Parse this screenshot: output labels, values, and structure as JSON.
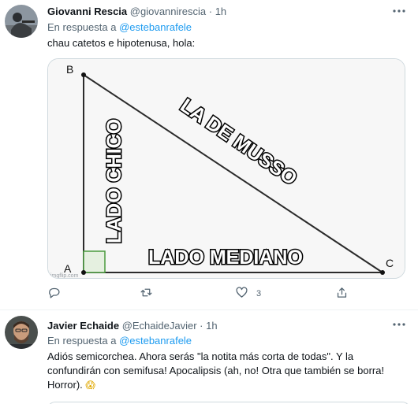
{
  "tweets": [
    {
      "name": "Giovanni Rescia",
      "handle": "@giovannirescia",
      "dot": "·",
      "time": "1h",
      "reply_prefix": "En respuesta a ",
      "reply_mention": "@estebanrafele",
      "text": "chau catetos e hipotenusa, hola:",
      "media": {
        "vertex_b": "B",
        "vertex_a": "A",
        "vertex_c": "C",
        "label_left": "LADO CHICO",
        "label_hyp": "LA DE MUSSO",
        "label_bottom": "LADO MEDIANO",
        "watermark": "imgflip.com"
      },
      "stats": {
        "likes": "3"
      }
    },
    {
      "name": "Javier Echaide",
      "handle": "@EchaideJavier",
      "dot": "·",
      "time": "1h",
      "reply_prefix": "En respuesta a ",
      "reply_mention": "@estebanrafele",
      "text": "Adiós semicorchea. Ahora serás \"la notita más corta de todas\". Y la confundirán con semifusa! Apocalipsis (ah, no! Otra que también se borra! Horror).",
      "emoji": "😱"
    }
  ],
  "icons": {
    "more": "more-horizontal-icon",
    "reply": "reply-icon",
    "retweet": "retweet-icon",
    "like": "heart-icon",
    "share": "share-icon"
  },
  "colors": {
    "accent": "#1d9bf0",
    "secondary_text": "#536471",
    "primary_text": "#0f1419"
  }
}
